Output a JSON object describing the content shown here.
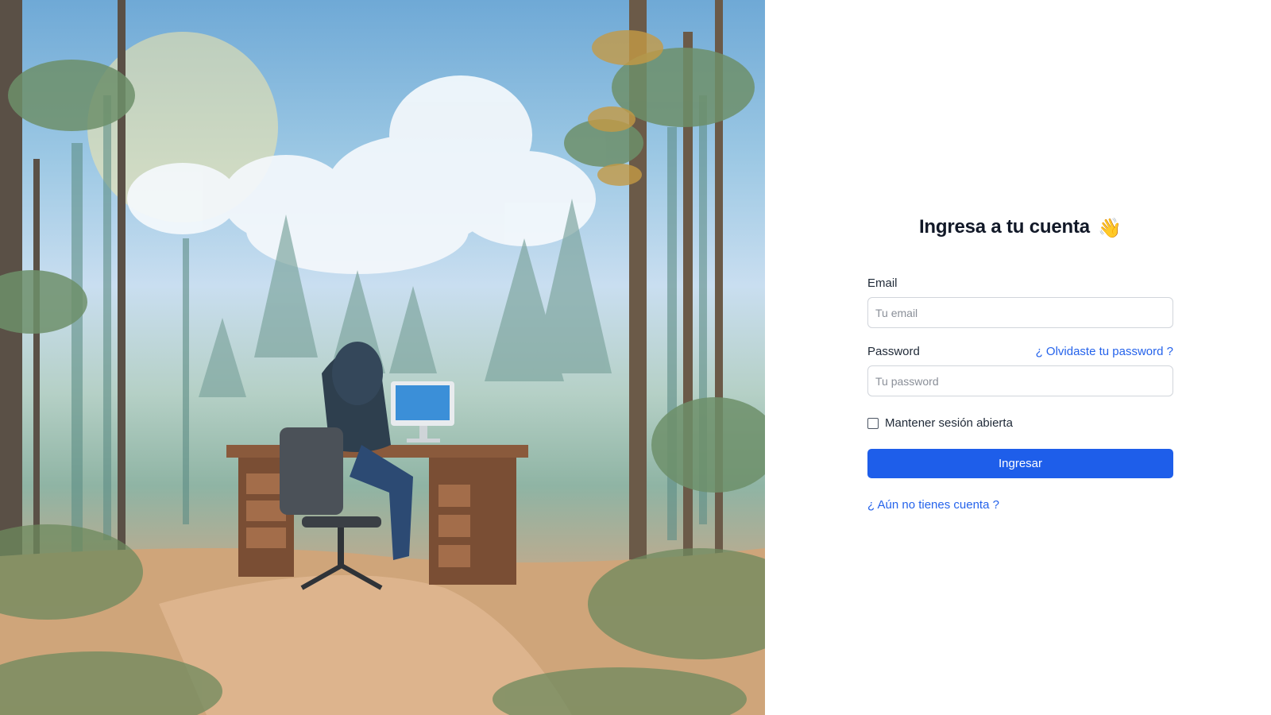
{
  "colors": {
    "primary": "#1e5eea",
    "link": "#2563eb",
    "input_border": "#d1d5db",
    "text": "#1f2937"
  },
  "hero": {
    "icon": "watercolor-forest-illustration"
  },
  "login": {
    "title": "Ingresa a tu cuenta",
    "title_emoji": "👋",
    "email": {
      "label": "Email",
      "placeholder": "Tu email",
      "value": ""
    },
    "password": {
      "label": "Password",
      "placeholder": "Tu password",
      "value": "",
      "forgot_link": "¿ Olvidaste tu password ?"
    },
    "remember": {
      "label": "Mantener sesión abierta",
      "checked": false
    },
    "submit_label": "Ingresar",
    "signup_link": "¿ Aún no tienes cuenta ?"
  }
}
